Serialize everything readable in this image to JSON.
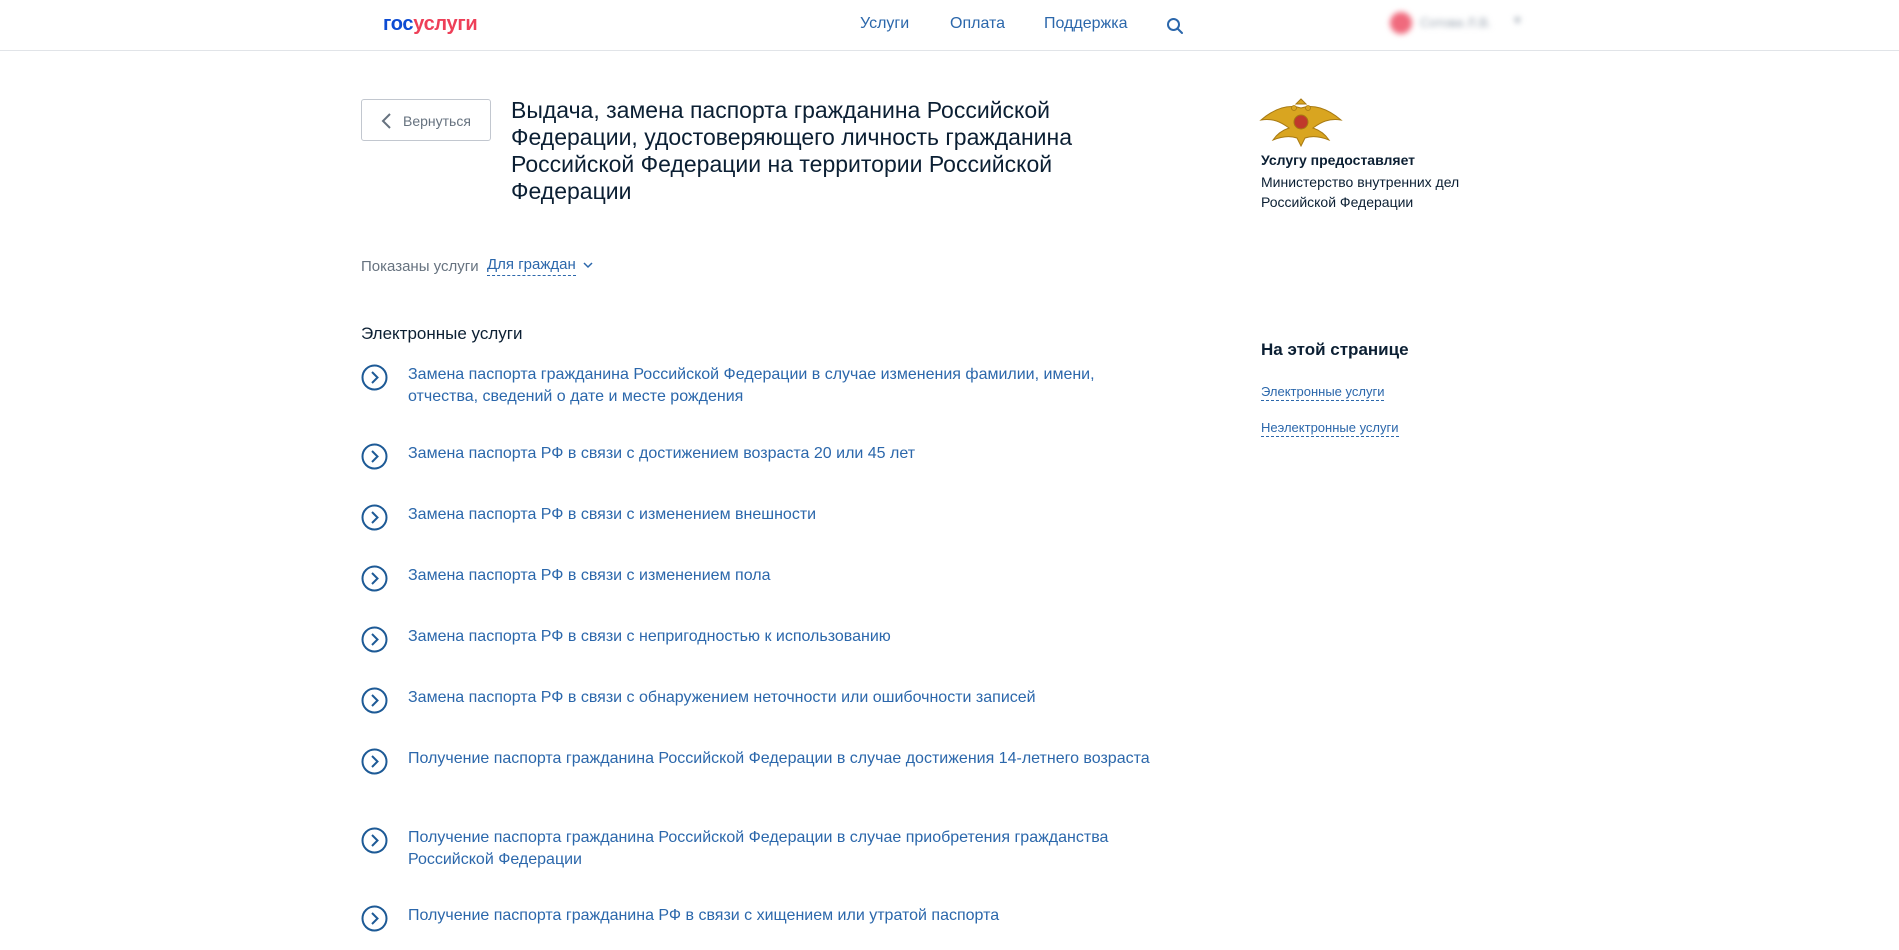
{
  "header": {
    "logo_part1": "гос",
    "logo_part2": "услуги",
    "nav": {
      "services": "Услуги",
      "payment": "Оплата",
      "support": "Поддержка"
    },
    "search_icon": "search-icon",
    "user_name": "Сотова Л.В."
  },
  "back_button": {
    "label": "Вернуться"
  },
  "page": {
    "title": "Выдача, замена паспорта гражданина Российской Федерации, удостоверяющего личность гражданина Российской Федерации на территории Российской Федерации"
  },
  "filter": {
    "label": "Показаны услуги",
    "value": "Для граждан"
  },
  "electronic": {
    "title": "Электронные услуги",
    "items": [
      "Замена паспорта гражданина Российской Федерации в случае изменения фамилии, имени, отчества, сведений о дате и месте рождения",
      "Замена паспорта РФ в связи с достижением возраста 20 или 45 лет",
      "Замена паспорта РФ в связи с изменением внешности",
      "Замена паспорта РФ в связи с изменением пола",
      "Замена паспорта РФ в связи с непригодностью к использованию",
      "Замена паспорта РФ в связи с обнаружением неточности или ошибочности записей",
      "Получение паспорта гражданина Российской Федерации в случае достижения 14-летнего возраста",
      "Получение паспорта гражданина Российской Федерации в случае приобретения гражданства Российской Федерации",
      "Получение паспорта гражданина РФ в связи с хищением или утратой паспорта"
    ]
  },
  "sidebar": {
    "provider_label": "Услугу предоставляет",
    "provider_name": "Министерство внутренних дел Российской Федерации",
    "toc_title": "На этой странице",
    "toc_links": [
      "Электронные услуги",
      "Неэлектронные услуги"
    ]
  },
  "colors": {
    "link": "#2b67ab",
    "brand_blue": "#0d4cd3",
    "brand_red": "#ee3f58",
    "text": "#0b1f33"
  }
}
